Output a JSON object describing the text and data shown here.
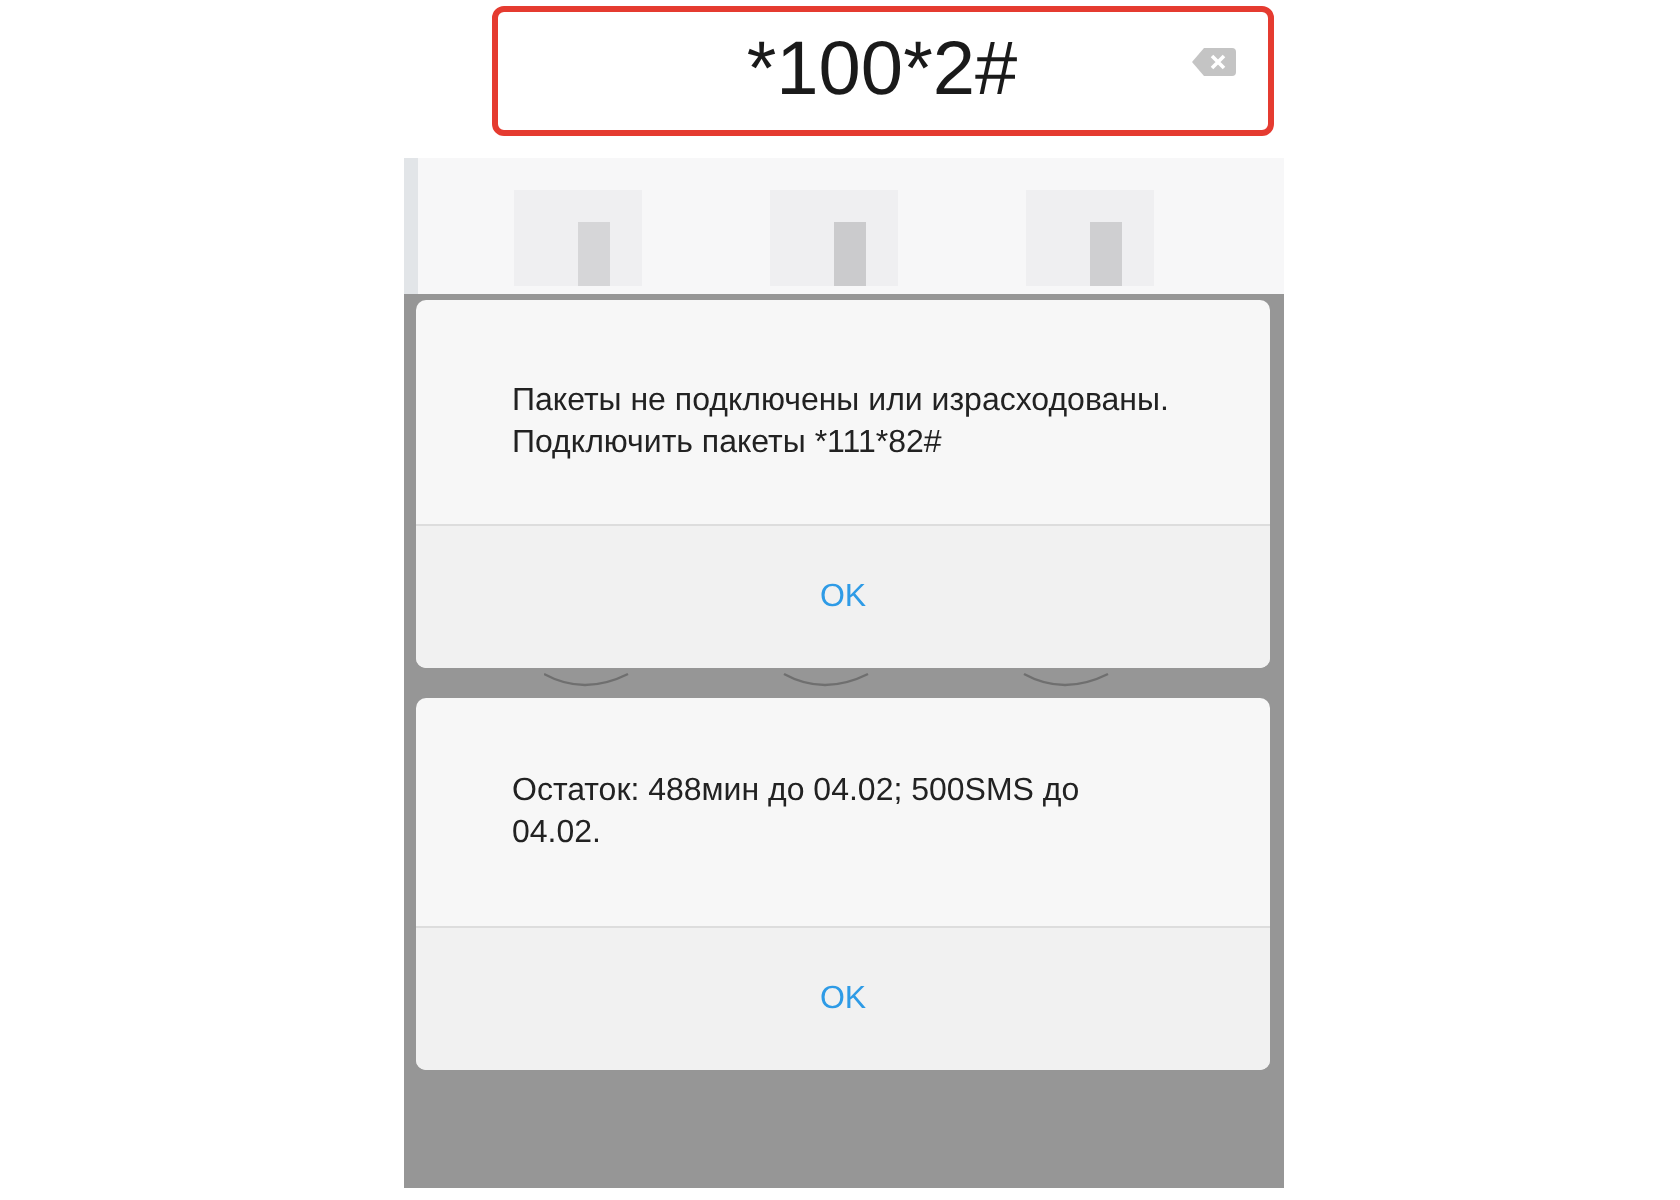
{
  "dial_field": {
    "value": "*100*2#"
  },
  "dialogs": [
    {
      "message": "Пакеты не подключены или израсходованы. Подключить пакеты *111*82#",
      "button": "OK"
    },
    {
      "message": "Остаток: 488мин до 04.02; 500SMS до 04.02.",
      "button": "OK"
    }
  ]
}
